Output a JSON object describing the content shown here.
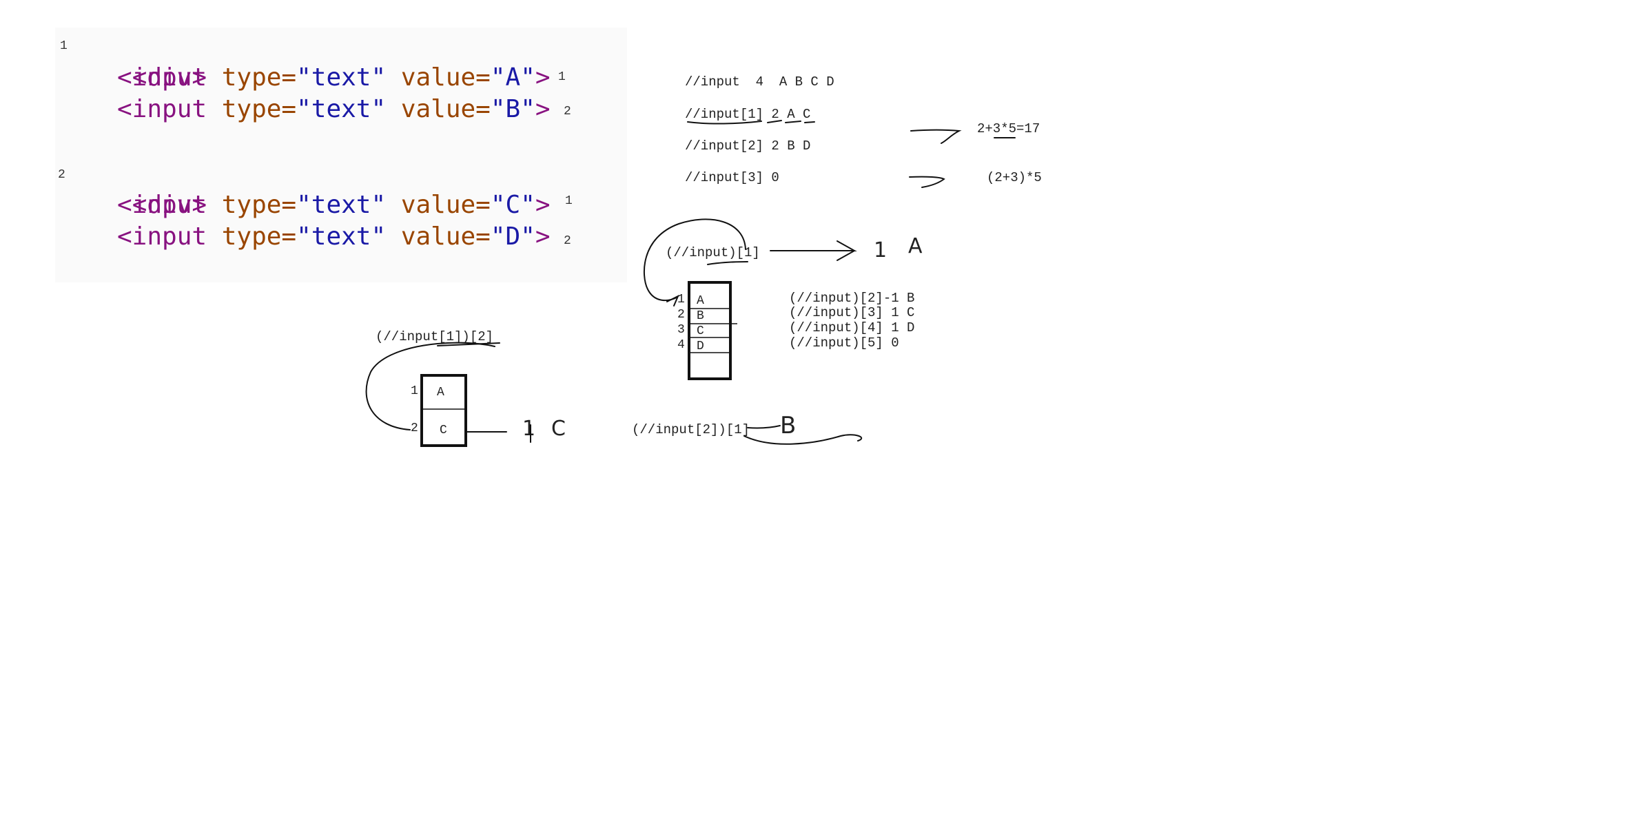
{
  "code": {
    "div1": {
      "index": "1",
      "open": "<div>"
    },
    "div1_input1": {
      "tag_open": "<input ",
      "type_attr": "type=",
      "type_val": "\"text\"",
      "value_attr": " value=",
      "value_val": "\"A\"",
      "tag_close": ">",
      "index": "1"
    },
    "div1_input2": {
      "tag_open": "<input ",
      "type_attr": "type=",
      "type_val": "\"text\"",
      "value_attr": " value=",
      "value_val": "\"B\"",
      "tag_close": ">",
      "index": "2"
    },
    "div2": {
      "index": "2",
      "open": "<div>"
    },
    "div2_input1": {
      "tag_open": "<input ",
      "type_attr": "type=",
      "type_val": "\"text\"",
      "value_attr": " value=",
      "value_val": "\"C\"",
      "tag_close": ">",
      "index": "1"
    },
    "div2_input2": {
      "tag_open": "<input ",
      "type_attr": "type=",
      "type_val": "\"text\"",
      "value_attr": " value=",
      "value_val": "\"D\"",
      "tag_close": ">",
      "index": "2"
    }
  },
  "notes": {
    "xpath_all": "//input  4  A B C D",
    "xpath_first": "//input[1] 2 A C",
    "xpath_second": "//input[2] 2 B D",
    "xpath_third": "//input[3] 0",
    "precedence_1": "2+3*5=17",
    "precedence_2": "(2+3)*5",
    "grouped_first": "(//input)[1]",
    "grouped_first_result_count": "1",
    "grouped_first_result_value": "A",
    "grouped_list": [
      "(//input)[2]-1 B",
      "(//input)[3] 1 C",
      "(//input)[4] 1 D",
      "(//input)[5] 0"
    ],
    "grouped_nested_2": "(//input[1])[2]",
    "grouped_nested_2_count": "1",
    "grouped_nested_2_value": "C",
    "grouped_nested_1": "(//input[2])[1]",
    "grouped_nested_1_value": "B"
  },
  "box_all": {
    "rows": [
      {
        "index": "1",
        "value": "A"
      },
      {
        "index": "2",
        "value": "B"
      },
      {
        "index": "3",
        "value": "C"
      },
      {
        "index": "4",
        "value": "D"
      }
    ]
  },
  "box_first": {
    "rows": [
      {
        "index": "1",
        "value": "A"
      },
      {
        "index": "2",
        "value": "C"
      }
    ]
  }
}
